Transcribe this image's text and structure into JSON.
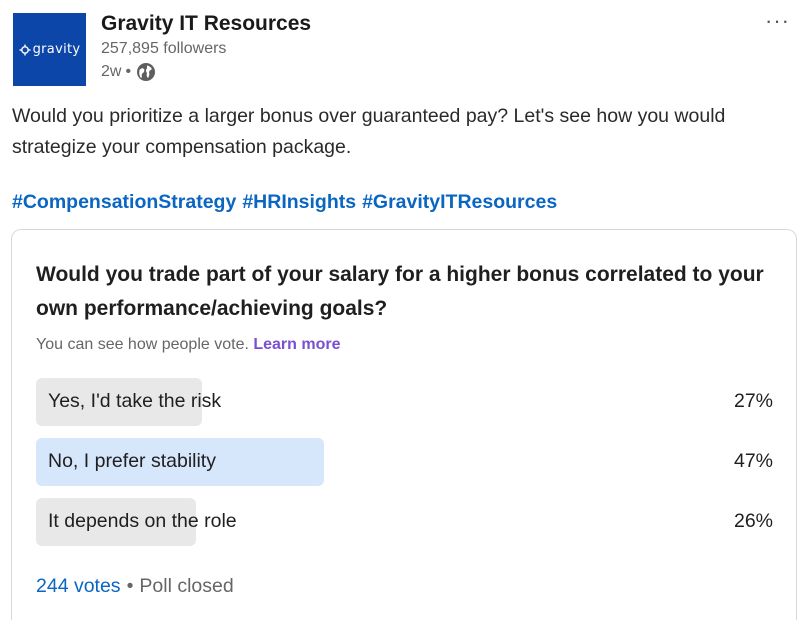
{
  "company": {
    "logo_text": "gravity",
    "name": "Gravity IT Resources",
    "followers": "257,895 followers",
    "time": "2w",
    "dot": "•"
  },
  "menu": {
    "more": "···"
  },
  "post": {
    "text": "Would you prioritize a larger bonus over guaranteed pay? Let's see how you would strategize your compensation package.",
    "hashtags": [
      "#CompensationStrategy",
      "#HRInsights",
      "#GravityITResources"
    ]
  },
  "poll": {
    "question": "Would you trade part of your salary for a higher bonus correlated to your own performance/achieving goals?",
    "note": "You can see how people vote.",
    "learn_more": "Learn more",
    "options": [
      {
        "label": "Yes, I'd take the risk",
        "percent": "27%",
        "value": 27,
        "selected": false
      },
      {
        "label": "No, I prefer stability",
        "percent": "47%",
        "value": 47,
        "selected": true
      },
      {
        "label": "It depends on the role",
        "percent": "26%",
        "value": 26,
        "selected": false
      }
    ],
    "votes": "244 votes",
    "separator": "•",
    "status": "Poll closed"
  },
  "colors": {
    "brand_blue": "#0c46a8",
    "link_blue": "#0a66c2",
    "learn_more_purple": "#7a4fd0",
    "selected_bar": "#d6e6fb",
    "unselected_bar": "#e8e8e8"
  },
  "icons": {
    "visibility": "globe-icon",
    "menu": "more-options-icon"
  }
}
